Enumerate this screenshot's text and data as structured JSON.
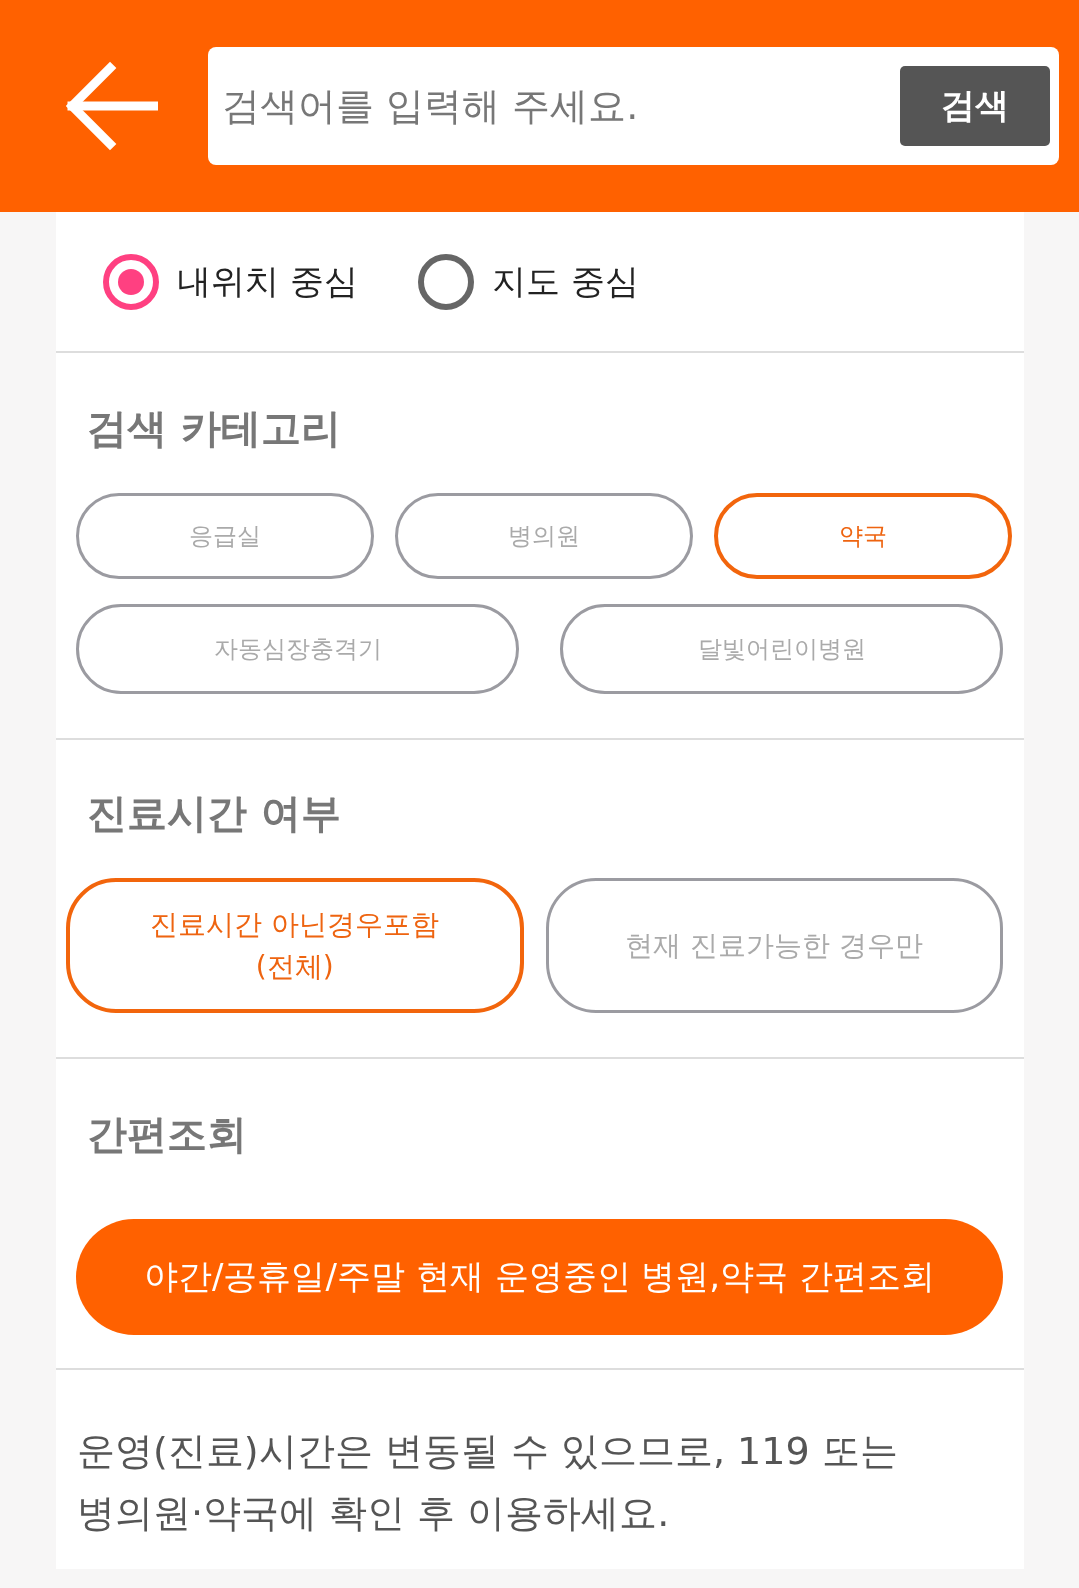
{
  "header": {
    "search": {
      "placeholder": "검색어를 입력해 주세요.",
      "button": "검색"
    }
  },
  "location_modes": [
    {
      "label": "내위치 중심",
      "selected": true
    },
    {
      "label": "지도 중심",
      "selected": false
    }
  ],
  "category_section": {
    "title": "검색 카테고리",
    "rows": [
      {
        "options": [
          {
            "label": "응급실",
            "selected": false
          },
          {
            "label": "병의원",
            "selected": false
          },
          {
            "label": "약국",
            "selected": true
          }
        ]
      },
      {
        "options": [
          {
            "label": "자동심장충격기",
            "selected": false
          },
          {
            "label": "달빛어린이병원",
            "selected": false
          }
        ]
      }
    ]
  },
  "hours_section": {
    "title": "진료시간 여부",
    "rows": [
      {
        "options": [
          {
            "label": "진료시간 아닌경우포함\n(전체)",
            "selected": true
          },
          {
            "label": "현재 진료가능한 경우만",
            "selected": false
          }
        ]
      }
    ]
  },
  "quick_section": {
    "title": "간편조회",
    "button": "야간/공휴일/주말 현재 운영중인 병원,약국 간편조회"
  },
  "notice": "운영(진료)시간은 변동될 수 있으므로, 119 또는\n병의원·약국에 확인 후 이용하세요."
}
